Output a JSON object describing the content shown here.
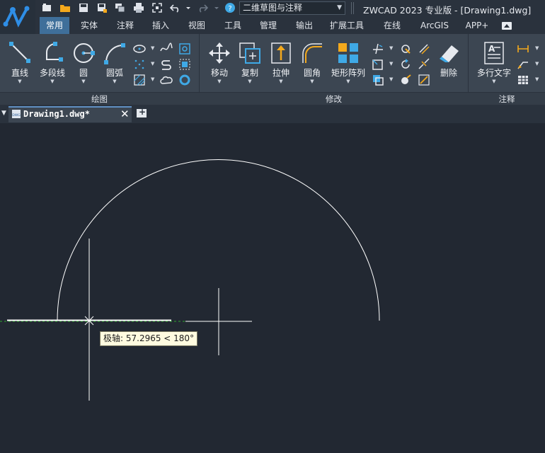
{
  "app": {
    "title": "ZWCAD 2023 专业版 - [Drawing1.dwg]",
    "workspace": "二维草图与注释"
  },
  "quick_access": [
    "new-file-icon",
    "open-folder-icon",
    "save-icon",
    "save-as-icon",
    "layers-icon",
    "print-icon",
    "fullscreen-icon",
    "undo-icon",
    "redo-icon",
    "help-icon"
  ],
  "ribbon_tabs": [
    "常用",
    "实体",
    "注释",
    "插入",
    "视图",
    "工具",
    "管理",
    "输出",
    "扩展工具",
    "在线",
    "ArcGIS",
    "APP+"
  ],
  "active_tab": "常用",
  "panels": {
    "draw": {
      "label": "绘图",
      "tools": [
        "直线",
        "多段线",
        "圆",
        "圆弧"
      ]
    },
    "modify": {
      "label": "修改",
      "tools": [
        "移动",
        "复制",
        "拉伸",
        "圆角",
        "矩形阵列",
        "删除"
      ]
    },
    "annotate": {
      "label": "注释",
      "tools": [
        "多行文字"
      ]
    }
  },
  "document": {
    "tab_name": "Drawing1.dwg*",
    "icon_text": "DWG"
  },
  "tooltip": {
    "text": "极轴: 57.2965 < 180°"
  },
  "colors": {
    "accent": "#3f6f9a",
    "canvas": "#222832",
    "ribbon": "#3c4652",
    "tool_blue": "#3fa9e6",
    "tool_orange": "#f4a91c",
    "polar_track": "#2fa82f"
  }
}
